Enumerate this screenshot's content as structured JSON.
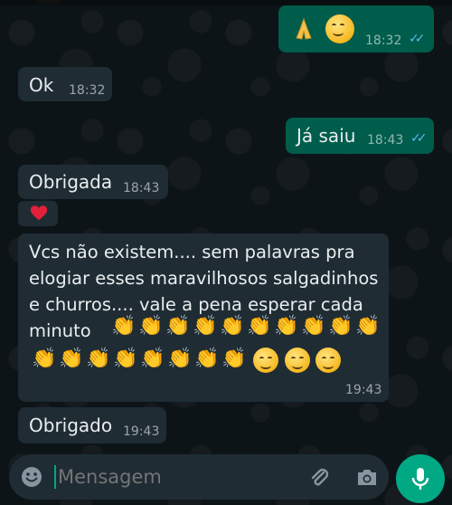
{
  "colors": {
    "outgoing_bubble": "#005c4b",
    "incoming_bubble": "#1f2c34",
    "read_ticks": "#53bdeb",
    "mic_button": "#00a884",
    "background": "#0d1418"
  },
  "messages": [
    {
      "direction": "out",
      "content_icons": [
        "folded-hands-emoji",
        "smiling-face-emoji"
      ],
      "time": "18:32",
      "status": "read"
    },
    {
      "direction": "in",
      "text": "Ok",
      "time": "18:32"
    },
    {
      "direction": "out",
      "text": "Já saiu",
      "time": "18:43",
      "status": "read"
    },
    {
      "direction": "in",
      "text": "Obrigada",
      "time": "18:43"
    },
    {
      "direction": "in",
      "content_icons": [
        "red-heart-emoji"
      ]
    },
    {
      "direction": "in",
      "text": "Vcs não  existem.... sem palavras pra elogiar esses maravilhosos salgadinhos e churros.... vale a pena esperar cada minuto",
      "content_icons": [
        "clapping-hands-emoji x18",
        "smiling-blush-face-emoji x3"
      ],
      "time": "19:43"
    },
    {
      "direction": "in",
      "text": "Obrigado",
      "time": "19:43"
    }
  ],
  "composer": {
    "placeholder": "Mensagem",
    "icons": [
      "emoji-icon",
      "attach-icon",
      "camera-icon",
      "mic-icon"
    ]
  }
}
